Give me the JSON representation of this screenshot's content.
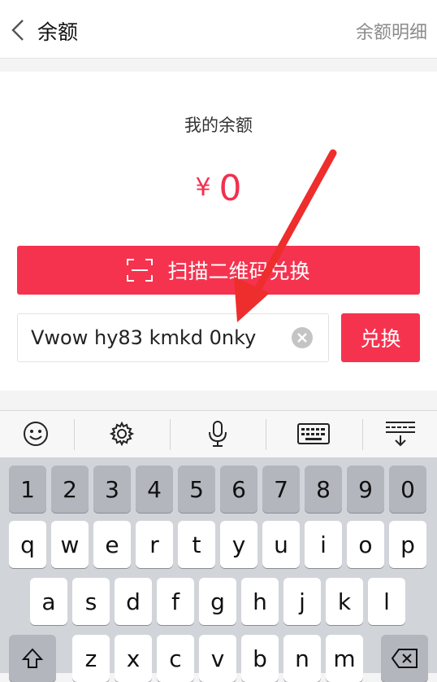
{
  "header": {
    "title": "余额",
    "detail_link": "余额明细",
    "back_icon": "chevron-left-icon"
  },
  "balance": {
    "label": "我的余额",
    "currency": "¥",
    "amount": "0"
  },
  "scan_button": {
    "label": "扫描二维码兑换",
    "icon": "scan-qr-icon"
  },
  "redeem": {
    "code_value": "Vwow hy83 kmkd 0nky",
    "button_label": "兑换",
    "clear_icon": "clear-icon"
  },
  "keyboard_toolbar": [
    "smiley-icon",
    "gear-icon",
    "microphone-icon",
    "keyboard-icon",
    "keyboard-collapse-icon"
  ],
  "keyboard": {
    "number_row": [
      "1",
      "2",
      "3",
      "4",
      "5",
      "6",
      "7",
      "8",
      "9",
      "0"
    ],
    "row1": [
      "q",
      "w",
      "e",
      "r",
      "t",
      "y",
      "u",
      "i",
      "o",
      "p"
    ],
    "row2": [
      "a",
      "s",
      "d",
      "f",
      "g",
      "h",
      "j",
      "k",
      "l"
    ],
    "row3": [
      "z",
      "x",
      "c",
      "v",
      "b",
      "n",
      "m"
    ],
    "shift_icon": "shift-icon",
    "delete_icon": "backspace-icon"
  },
  "colors": {
    "accent": "#f5334f",
    "amount": "#f2304f",
    "annotation_arrow": "#ee2d2d"
  }
}
